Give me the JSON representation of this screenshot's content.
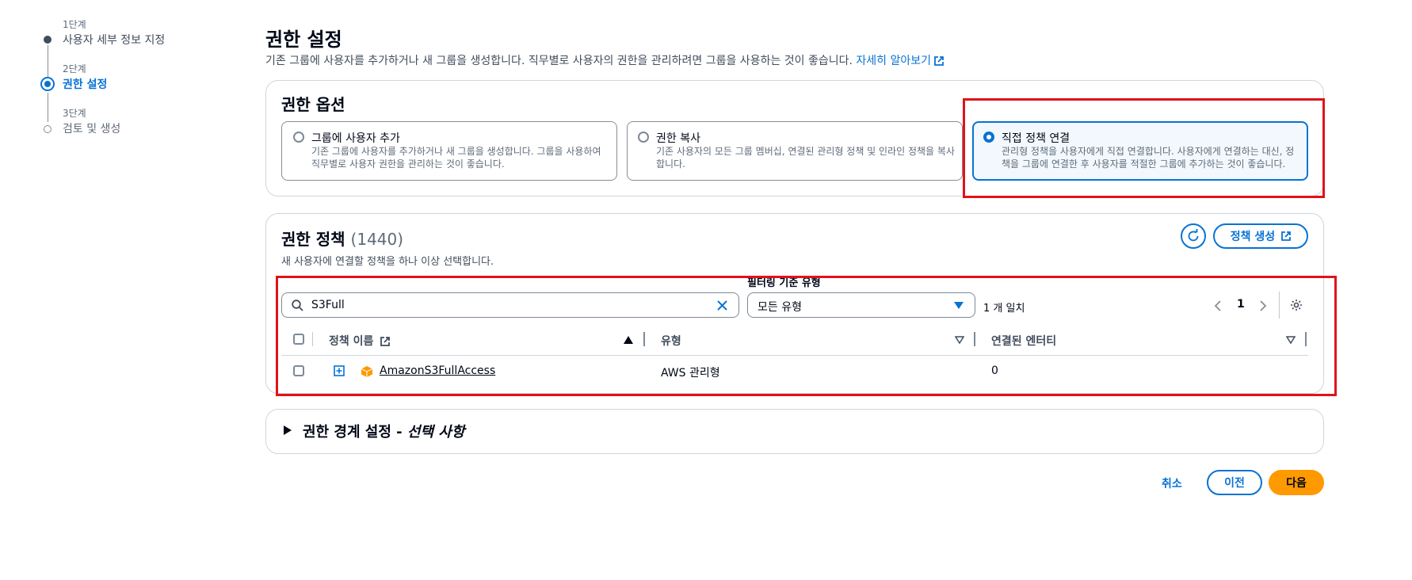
{
  "stepper": {
    "steps": [
      {
        "num": "1단계",
        "label": "사용자 세부 정보 지정"
      },
      {
        "num": "2단계",
        "label": "권한 설정"
      },
      {
        "num": "3단계",
        "label": "검토 및 생성"
      }
    ]
  },
  "header": {
    "title": "권한 설정",
    "description": "기존 그룹에 사용자를 추가하거나 새 그룹을 생성합니다. 직무별로 사용자의 권한을 관리하려면 그룹을 사용하는 것이 좋습니다.",
    "learn_more": "자세히 알아보기"
  },
  "options_panel": {
    "title": "권한 옵션",
    "tiles": [
      {
        "title": "그룹에 사용자 추가",
        "desc1": "기존 그룹에 사용자를 추가하거나 새 그룹을 생성합니다. 그룹을 사용하여",
        "desc2": "직무별로 사용자 권한을 관리하는 것이 좋습니다."
      },
      {
        "title": "권한 복사",
        "desc1": "기존 사용자의 모든 그룹 멤버십, 연결된 관리형 정책 및 인라인 정책을 복사",
        "desc2": "합니다."
      },
      {
        "title": "직접 정책 연결",
        "desc1": "관리형 정책을 사용자에게 직접 연결합니다. 사용자에게 연결하는 대신, 정",
        "desc2": "책을 그룹에 연결한 후 사용자를 적절한 그룹에 추가하는 것이 좋습니다."
      }
    ]
  },
  "policies_panel": {
    "title": "권한 정책",
    "count": "(1440)",
    "subtitle": "새 사용자에 연결할 정책을 하나 이상 선택합니다.",
    "create_button": "정책 생성",
    "filter_label": "필터링 기준 유형",
    "search_value": "S3Full",
    "type_select": "모든 유형",
    "match_count": "1 개 일치",
    "page_number": "1",
    "columns": {
      "name": "정책 이름",
      "type": "유형",
      "entities": "연결된 엔터티"
    },
    "rows": [
      {
        "name": "AmazonS3FullAccess",
        "type": "AWS 관리형",
        "entities": "0"
      }
    ]
  },
  "boundary_panel": {
    "title": "권한 경계 설정 - ",
    "title_italic": "선택 사항"
  },
  "footer": {
    "cancel": "취소",
    "previous": "이전",
    "next": "다음"
  },
  "colors": {
    "accent": "#0972d3",
    "primary_button": "#ff9900",
    "highlight": "#e0131b"
  }
}
